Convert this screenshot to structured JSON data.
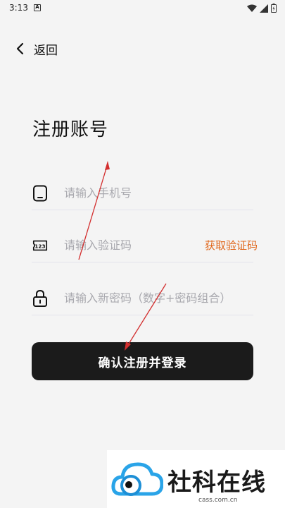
{
  "status_bar": {
    "time": "3:13",
    "notif_letter": "A"
  },
  "header": {
    "back_label": "返回"
  },
  "page": {
    "title": "注册账号"
  },
  "form": {
    "phone": {
      "placeholder": "请输入手机号",
      "value": ""
    },
    "code": {
      "placeholder": "请输入验证码",
      "value": "",
      "get_code_label": "获取验证码"
    },
    "password": {
      "placeholder": "请输入新密码（数字+密码组合）",
      "value": ""
    }
  },
  "submit": {
    "label": "确认注册并登录"
  },
  "watermark": {
    "text": "社科在线",
    "url": "cass.com.cn"
  },
  "colors": {
    "accent": "#e0661a",
    "button": "#1b1b1b",
    "background": "#f4f4f4",
    "arrow": "#d32f2f"
  }
}
